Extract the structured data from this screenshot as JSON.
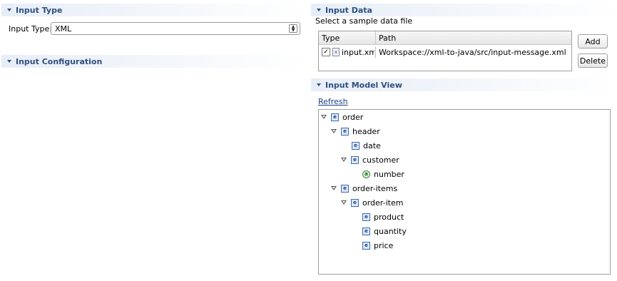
{
  "input_type": {
    "section_title": "Input Type",
    "label": "Input Type:",
    "selected": "XML"
  },
  "input_configuration": {
    "section_title": "Input Configuration"
  },
  "input_data": {
    "section_title": "Input Data",
    "instruction": "Select a sample data file",
    "columns": [
      "Type",
      "Path"
    ],
    "rows": [
      {
        "checked": true,
        "type": "input.xml",
        "path": "Workspace://xml-to-java/src/input-message.xml"
      }
    ],
    "add_label": "Add",
    "delete_label": "Delete"
  },
  "input_model_view": {
    "section_title": "Input Model View",
    "refresh_label": "Refresh",
    "tree": [
      {
        "label": "order",
        "kind": "element",
        "expanded": true
      },
      {
        "label": "header",
        "kind": "element",
        "expanded": true
      },
      {
        "label": "date",
        "kind": "element"
      },
      {
        "label": "customer",
        "kind": "element",
        "expanded": true
      },
      {
        "label": "number",
        "kind": "attribute"
      },
      {
        "label": "order-items",
        "kind": "element",
        "expanded": true
      },
      {
        "label": "order-item",
        "kind": "element",
        "expanded": true
      },
      {
        "label": "product",
        "kind": "element"
      },
      {
        "label": "quantity",
        "kind": "element"
      },
      {
        "label": "price",
        "kind": "element"
      }
    ]
  },
  "icons": {
    "element_glyph": "e",
    "attribute_glyph": "a",
    "xml_file_glyph": "x",
    "check_glyph": "✓"
  },
  "colors": {
    "section_title": "#2f4f7e",
    "link": "#1a3e8a"
  }
}
